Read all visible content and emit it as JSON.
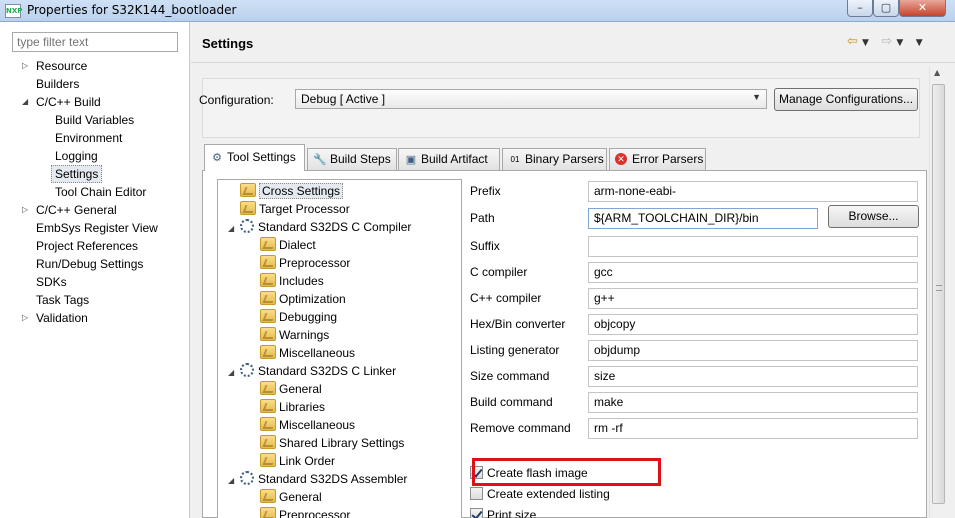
{
  "window": {
    "title": "Properties for S32K144_bootloader",
    "app_badge": "NXP",
    "minimize_glyph": "–",
    "maximize_glyph": "▢",
    "close_glyph": "✕"
  },
  "left_nav": {
    "filter_placeholder": "type filter text",
    "items": [
      {
        "label": "Resource"
      },
      {
        "label": "Builders"
      },
      {
        "label": "C/C++ Build"
      },
      {
        "label": "Build Variables"
      },
      {
        "label": "Environment"
      },
      {
        "label": "Logging"
      },
      {
        "label": "Settings"
      },
      {
        "label": "Tool Chain Editor"
      },
      {
        "label": "C/C++ General"
      },
      {
        "label": "EmbSys Register View"
      },
      {
        "label": "Project References"
      },
      {
        "label": "Run/Debug Settings"
      },
      {
        "label": "SDKs"
      },
      {
        "label": "Task Tags"
      },
      {
        "label": "Validation"
      }
    ]
  },
  "header": {
    "title": "Settings",
    "back_glyph": "⇦",
    "forward_glyph": "⇨",
    "dropdown_glyph": "▼",
    "menu_glyph": "▼"
  },
  "configuration": {
    "label": "Configuration:",
    "value": "Debug  [ Active ]",
    "manage_button": "Manage Configurations..."
  },
  "tabs": [
    {
      "label": "Tool Settings",
      "icon": "gear-icon",
      "active": true
    },
    {
      "label": "Build Steps",
      "icon": "wrench-icon",
      "active": false
    },
    {
      "label": "Build Artifact",
      "icon": "artifact-icon",
      "active": false
    },
    {
      "label": "Binary Parsers",
      "icon": "binary-icon",
      "active": false
    },
    {
      "label": "Error Parsers",
      "icon": "error-icon",
      "active": false
    }
  ],
  "tool_tree": [
    {
      "label": "Cross Settings"
    },
    {
      "label": "Target Processor"
    },
    {
      "label": "Standard S32DS C Compiler"
    },
    {
      "label": "Dialect"
    },
    {
      "label": "Preprocessor"
    },
    {
      "label": "Includes"
    },
    {
      "label": "Optimization"
    },
    {
      "label": "Debugging"
    },
    {
      "label": "Warnings"
    },
    {
      "label": "Miscellaneous"
    },
    {
      "label": "Standard S32DS C Linker"
    },
    {
      "label": "General"
    },
    {
      "label": "Libraries"
    },
    {
      "label": "Miscellaneous"
    },
    {
      "label": "Shared Library Settings"
    },
    {
      "label": "Link Order"
    },
    {
      "label": "Standard S32DS Assembler"
    },
    {
      "label": "General"
    },
    {
      "label": "Preprocessor"
    }
  ],
  "fields": [
    {
      "label": "Prefix",
      "value": "arm-none-eabi-"
    },
    {
      "label": "Path",
      "value": "${ARM_TOOLCHAIN_DIR}/bin"
    },
    {
      "label": "Suffix",
      "value": ""
    },
    {
      "label": "C compiler",
      "value": "gcc"
    },
    {
      "label": "C++ compiler",
      "value": "g++"
    },
    {
      "label": "Hex/Bin converter",
      "value": "objcopy"
    },
    {
      "label": "Listing generator",
      "value": "objdump"
    },
    {
      "label": "Size command",
      "value": "size"
    },
    {
      "label": "Build command",
      "value": "make"
    },
    {
      "label": "Remove command",
      "value": "rm -rf"
    }
  ],
  "browse_button": "Browse...",
  "checkboxes": [
    {
      "label": "Create flash image",
      "checked": true
    },
    {
      "label": "Create extended listing",
      "checked": false
    },
    {
      "label": "Print size",
      "checked": true
    }
  ],
  "colors": {
    "highlight": "#e0101a",
    "selection": "#e5eaf1"
  }
}
